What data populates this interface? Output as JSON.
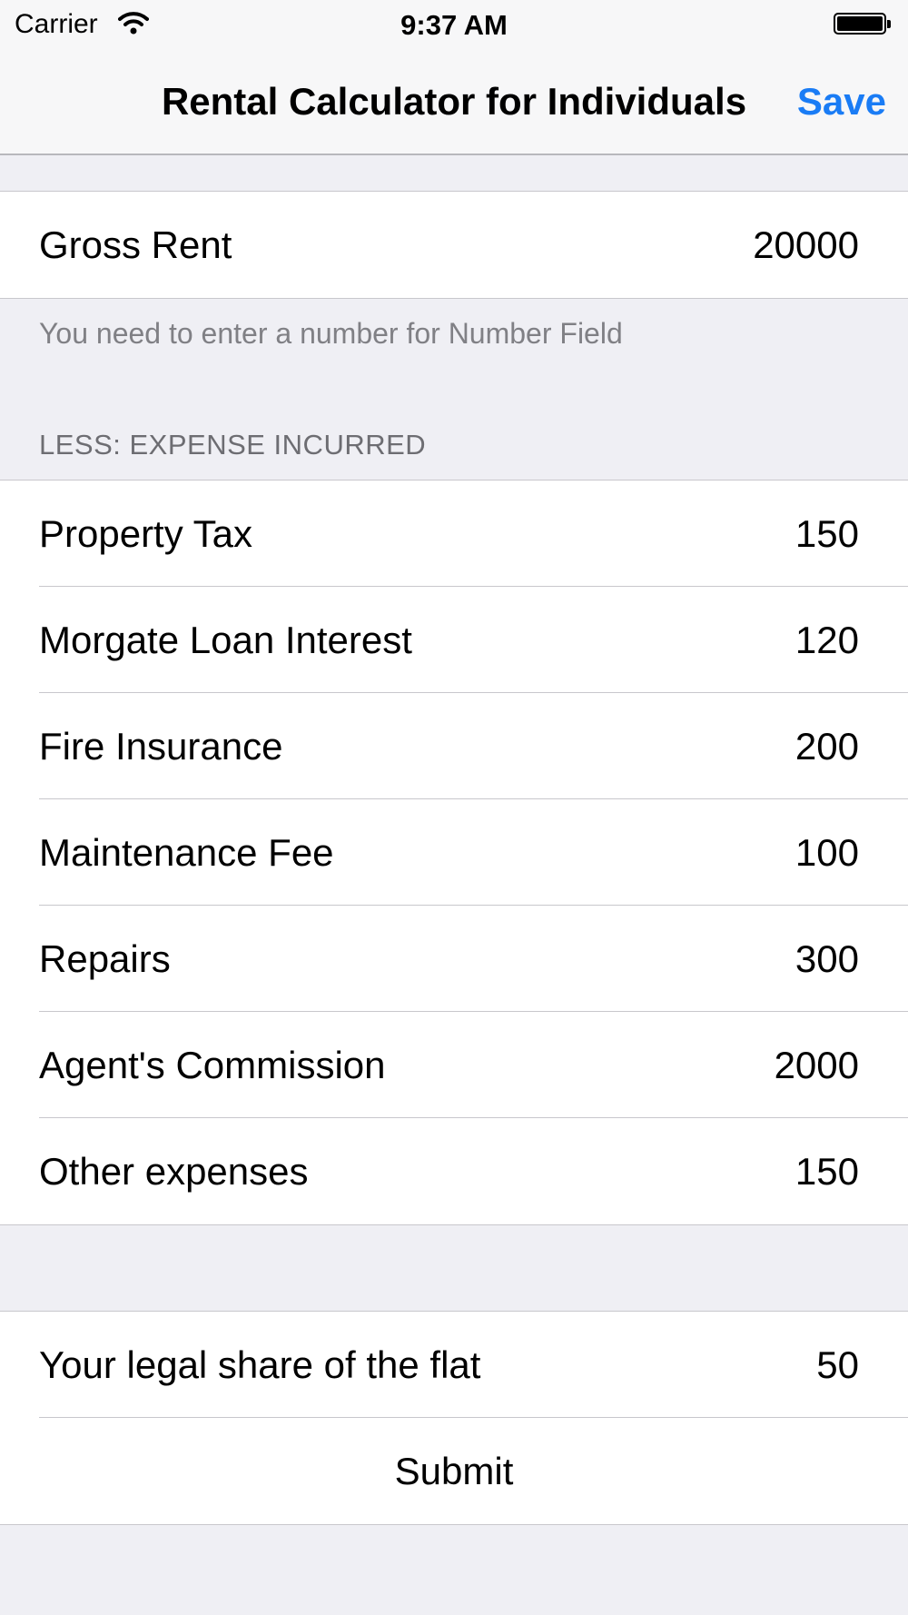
{
  "status_bar": {
    "carrier": "Carrier",
    "time": "9:37 AM",
    "wifi_icon": "wifi-icon",
    "battery_icon": "battery-icon"
  },
  "nav": {
    "title": "Rental Calculator for Individuals",
    "save_label": "Save",
    "accent_color": "#1a7cf5"
  },
  "gross": {
    "label": "Gross Rent",
    "value": "20000",
    "footer": "You need to enter a number for Number Field"
  },
  "expenses": {
    "header": "LESS: EXPENSE INCURRED",
    "items": [
      {
        "label": "Property Tax",
        "value": "150"
      },
      {
        "label": "Morgate Loan Interest",
        "value": "120"
      },
      {
        "label": "Fire Insurance",
        "value": "200"
      },
      {
        "label": "Maintenance Fee",
        "value": "100"
      },
      {
        "label": "Repairs",
        "value": "300"
      },
      {
        "label": "Agent's Commission",
        "value": "2000"
      },
      {
        "label": "Other expenses",
        "value": "150"
      }
    ]
  },
  "share": {
    "label": "Your legal share of the flat",
    "value": "50",
    "submit_label": "Submit"
  }
}
